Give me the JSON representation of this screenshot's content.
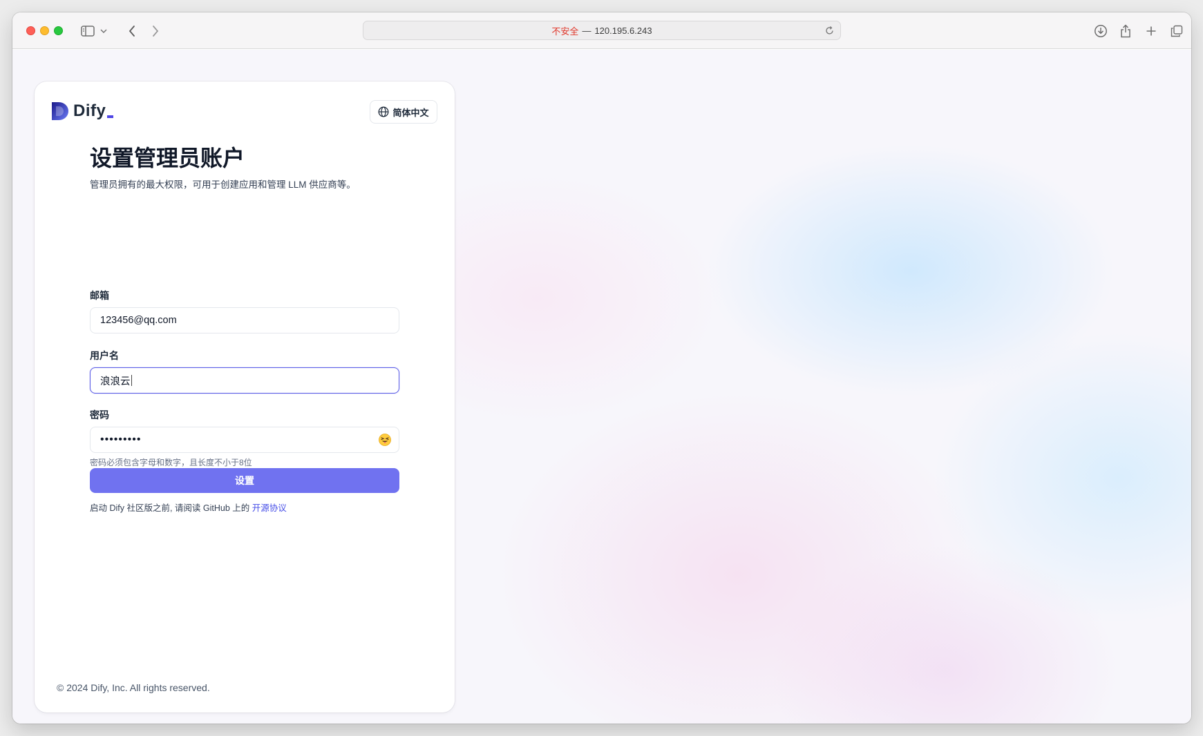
{
  "browser": {
    "address_security": "不安全",
    "address_separator": "—",
    "address_url": "120.195.6.243"
  },
  "logo": {
    "text": "Dify"
  },
  "language": {
    "label": "简体中文"
  },
  "page": {
    "title": "设置管理员账户",
    "subtitle": "管理员拥有的最大权限，可用于创建应用和管理 LLM 供应商等。"
  },
  "form": {
    "email_label": "邮箱",
    "email_value": "123456@qq.com",
    "username_label": "用户名",
    "username_value": "浪浪云",
    "password_label": "密码",
    "password_masked": "•••••••••",
    "password_hint": "密码必须包含字母和数字，且长度不小于8位",
    "submit_label": "设置",
    "agreement_text": "启动 Dify 社区版之前, 请阅读 GitHub 上的",
    "agreement_link": "开源协议"
  },
  "footer": {
    "copyright": "© 2024 Dify, Inc. All rights reserved."
  },
  "colors": {
    "primary": "#7072f0",
    "link": "#444ce7",
    "insecure": "#e0362a"
  }
}
